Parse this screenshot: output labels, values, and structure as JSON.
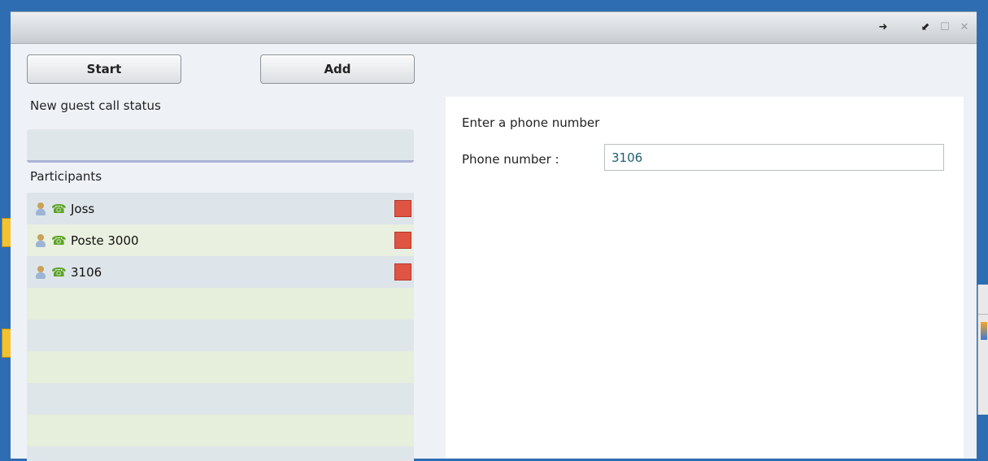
{
  "window": {
    "title_controls": [
      "pin-icon",
      "restore-icon",
      "maximize-icon",
      "close-icon"
    ]
  },
  "toolbar": {
    "start_label": "Start",
    "add_label": "Add"
  },
  "status": {
    "label": "New guest call status",
    "value": ""
  },
  "participants": {
    "label": "Participants",
    "items": [
      {
        "name": "Joss",
        "icons": [
          "user-icon",
          "phone-icon"
        ],
        "remove_icon": "remove-icon"
      },
      {
        "name": "Poste 3000",
        "icons": [
          "user-icon",
          "phone-icon"
        ],
        "remove_icon": "remove-icon"
      },
      {
        "name": "3106",
        "icons": [
          "user-icon",
          "phone-icon"
        ],
        "remove_icon": "remove-icon"
      }
    ]
  },
  "phone_form": {
    "heading": "Enter a phone number",
    "field_label": "Phone number :",
    "field_value": "3106"
  },
  "colors": {
    "remove": "#e05444",
    "phone_icon": "#5aa322",
    "desktop": "#2f6db3"
  }
}
